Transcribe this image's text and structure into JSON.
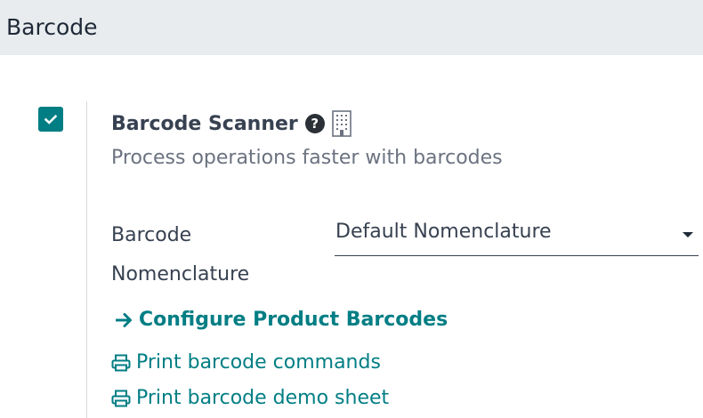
{
  "section": {
    "title": "Barcode"
  },
  "setting": {
    "enabled": true,
    "title": "Barcode Scanner",
    "help_icon": "question-circle-icon",
    "company_icon": "building-icon",
    "description": "Process operations faster with barcodes"
  },
  "nomenclature": {
    "label": "Barcode Nomenclature",
    "value": "Default Nomenclature"
  },
  "links": {
    "configure_label": "Configure Product Barcodes",
    "print_commands_label": "Print barcode commands",
    "print_demo_label": "Print barcode demo sheet"
  },
  "colors": {
    "accent": "#017e84",
    "header_bg": "#e9ecef",
    "text": "#374151",
    "muted": "#6b7280"
  }
}
